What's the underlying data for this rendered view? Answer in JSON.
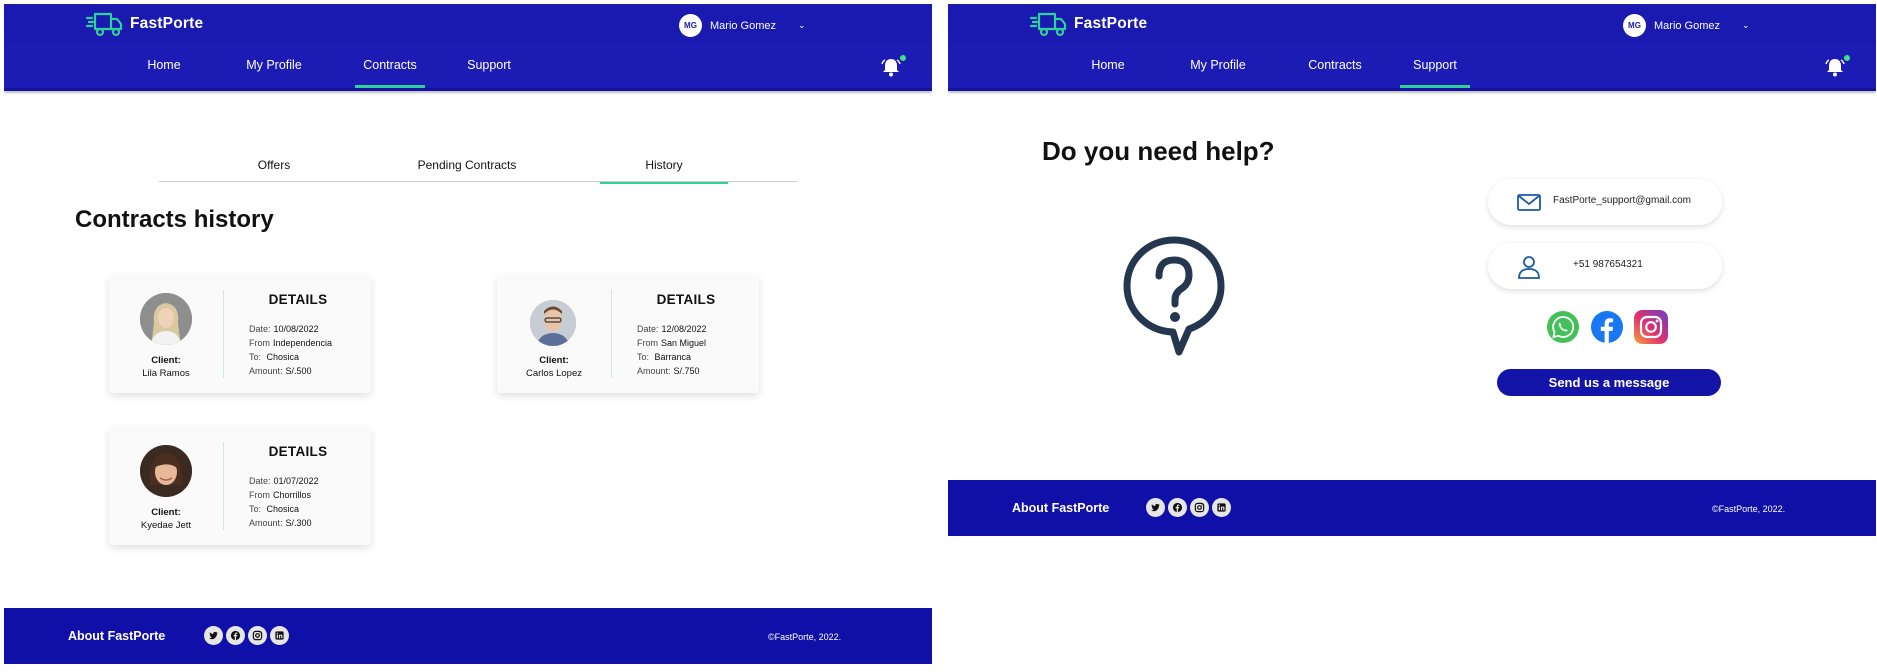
{
  "brand": {
    "name": "FastPorte",
    "accent": "#2fd19a",
    "primary": "#1a1ab0"
  },
  "user": {
    "initials": "MG",
    "name": "Mario Gomez"
  },
  "nav": {
    "items": [
      "Home",
      "My Profile",
      "Contracts",
      "Support"
    ]
  },
  "left": {
    "active_nav": "Contracts",
    "tabs": [
      "Offers",
      "Pending Contracts",
      "History"
    ],
    "active_tab": "History",
    "title": "Contracts history",
    "labels": {
      "details": "DETAILS",
      "client": "Client:",
      "date": "Date:",
      "from": "From",
      "to": "To:",
      "amount": "Amount:"
    },
    "contracts": [
      {
        "client": "Lila Ramos",
        "date": "10/08/2022",
        "from": "Independencia",
        "to": "Chosica",
        "amount": "S/.500"
      },
      {
        "client": "Carlos Lopez",
        "date": "12/08/2022",
        "from": "San Miguel",
        "to": "Barranca",
        "amount": "S/.750"
      },
      {
        "client": "Kyedae Jett",
        "date": "01/07/2022",
        "from": "Chorrillos",
        "to": "Chosica",
        "amount": "S/.300"
      }
    ]
  },
  "right": {
    "active_nav": "Support",
    "title": "Do you need help?",
    "email": "FastPorte_support@gmail.com",
    "phone": "+51 987654321",
    "send_button": "Send us a message",
    "social_icons": [
      "whatsapp-icon",
      "facebook-icon",
      "instagram-icon"
    ]
  },
  "footer": {
    "about": "About FastPorte",
    "copyright": "©FastPorte, 2022.",
    "social_icons": [
      "twitter-icon",
      "facebook-icon",
      "instagram-icon",
      "linkedin-icon"
    ]
  }
}
